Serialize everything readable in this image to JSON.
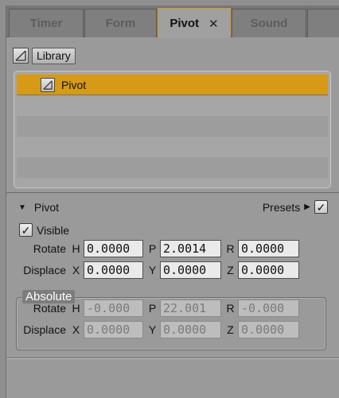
{
  "tabs": [
    {
      "label": "Timer",
      "active": false
    },
    {
      "label": "Form",
      "active": false
    },
    {
      "label": "Pivot",
      "active": true,
      "close": "✕"
    },
    {
      "label": "Sound",
      "active": false
    }
  ],
  "library": {
    "label": "Library"
  },
  "list": {
    "items": [
      {
        "label": "Pivot",
        "selected": true
      }
    ]
  },
  "pivot": {
    "title": "Pivot",
    "presets_label": "Presets",
    "visible_label": "Visible",
    "visible_checked": true,
    "presets_checked": true,
    "rotate": {
      "label": "Rotate",
      "h_label": "H",
      "h": "0.0000",
      "p_label": "P",
      "p": "2.0014",
      "r_label": "R",
      "r": "0.0000"
    },
    "displace": {
      "label": "Displace",
      "x_label": "X",
      "x": "0.0000",
      "y_label": "Y",
      "y": "0.0000",
      "z_label": "Z",
      "z": "0.0000"
    }
  },
  "absolute": {
    "title": "Absolute",
    "rotate": {
      "label": "Rotate",
      "h_label": "H",
      "h": "-0.000",
      "p_label": "P",
      "p": "22.001",
      "r_label": "R",
      "r": "-0.000"
    },
    "displace": {
      "label": "Displace",
      "x_label": "X",
      "x": "0.0000",
      "y_label": "Y",
      "y": "0.0000",
      "z_label": "Z",
      "z": "0.0000"
    }
  },
  "colors": {
    "accent": "#d69a16",
    "panel": "#9a9a9a"
  }
}
